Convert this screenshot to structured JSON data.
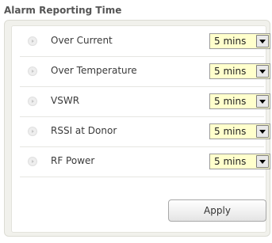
{
  "section": {
    "title": "Alarm Reporting Time"
  },
  "alarms": [
    {
      "label": "Over Current",
      "value": "5 mins"
    },
    {
      "label": "Over Temperature",
      "value": "5 mins"
    },
    {
      "label": "VSWR",
      "value": "5 mins"
    },
    {
      "label": "RSSI at Donor",
      "value": "5 mins"
    },
    {
      "label": "RF Power",
      "value": "5 mins"
    }
  ],
  "actions": {
    "apply_label": "Apply"
  },
  "icons": {
    "bullet": "arrow-bullet-icon",
    "dropdown": "chevron-down-icon"
  },
  "colors": {
    "select_bg": "#ffffcc",
    "panel_bg": "#f1f1ec",
    "title": "#555555"
  }
}
